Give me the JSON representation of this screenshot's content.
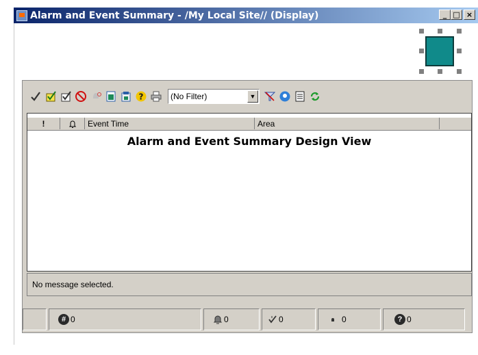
{
  "window": {
    "title": "Alarm and Event Summary - /My Local Site// (Display)",
    "minimize": "_",
    "maximize": "□",
    "close": "×"
  },
  "toolbar": {
    "filter_value": "(No Filter)",
    "icons": [
      "acknowledge-check-icon",
      "acknowledge-page-icon",
      "acknowledge-all-icon",
      "silence-icon",
      "shelve-icon",
      "details-icon",
      "properties-icon",
      "help-icon",
      "print-icon",
      "filter-icon",
      "find-icon",
      "report-icon",
      "refresh-icon"
    ]
  },
  "grid": {
    "columns": [
      "!",
      "",
      "Event Time",
      "Area"
    ],
    "design_label": "Alarm and Event Summary Design View"
  },
  "message": "No message selected.",
  "status": {
    "total": "0",
    "unacknowledged": "0",
    "acknowledged": "0",
    "priority": "0",
    "help": "0"
  },
  "colors": {
    "title_start": "#0a246a",
    "title_end": "#a6caf0",
    "selected_object": "#108a8a"
  }
}
